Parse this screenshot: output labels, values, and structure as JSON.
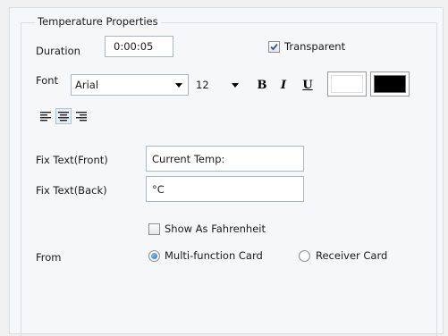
{
  "group": {
    "title": "Temperature Properties"
  },
  "duration": {
    "label": "Duration",
    "value": "0:00:05"
  },
  "transparent": {
    "label": "Transparent",
    "checked": true
  },
  "font": {
    "label": "Font",
    "family": "Arial",
    "size": "12",
    "bold": "B",
    "italic": "I",
    "underline": "U"
  },
  "colors": {
    "foreground": "#ffffff",
    "background": "#000000"
  },
  "alignment": {
    "options": [
      "left",
      "center",
      "right"
    ],
    "selected": "center"
  },
  "fix_front": {
    "label": "Fix Text(Front)",
    "value": "Current Temp:"
  },
  "fix_back": {
    "label": "Fix Text(Back)",
    "value": "°C"
  },
  "fahrenheit": {
    "label": "Show As Fahrenheit",
    "checked": false
  },
  "from": {
    "label": "From",
    "options": [
      "Multi-function Card",
      "Receiver Card"
    ],
    "selected": "Multi-function Card"
  }
}
